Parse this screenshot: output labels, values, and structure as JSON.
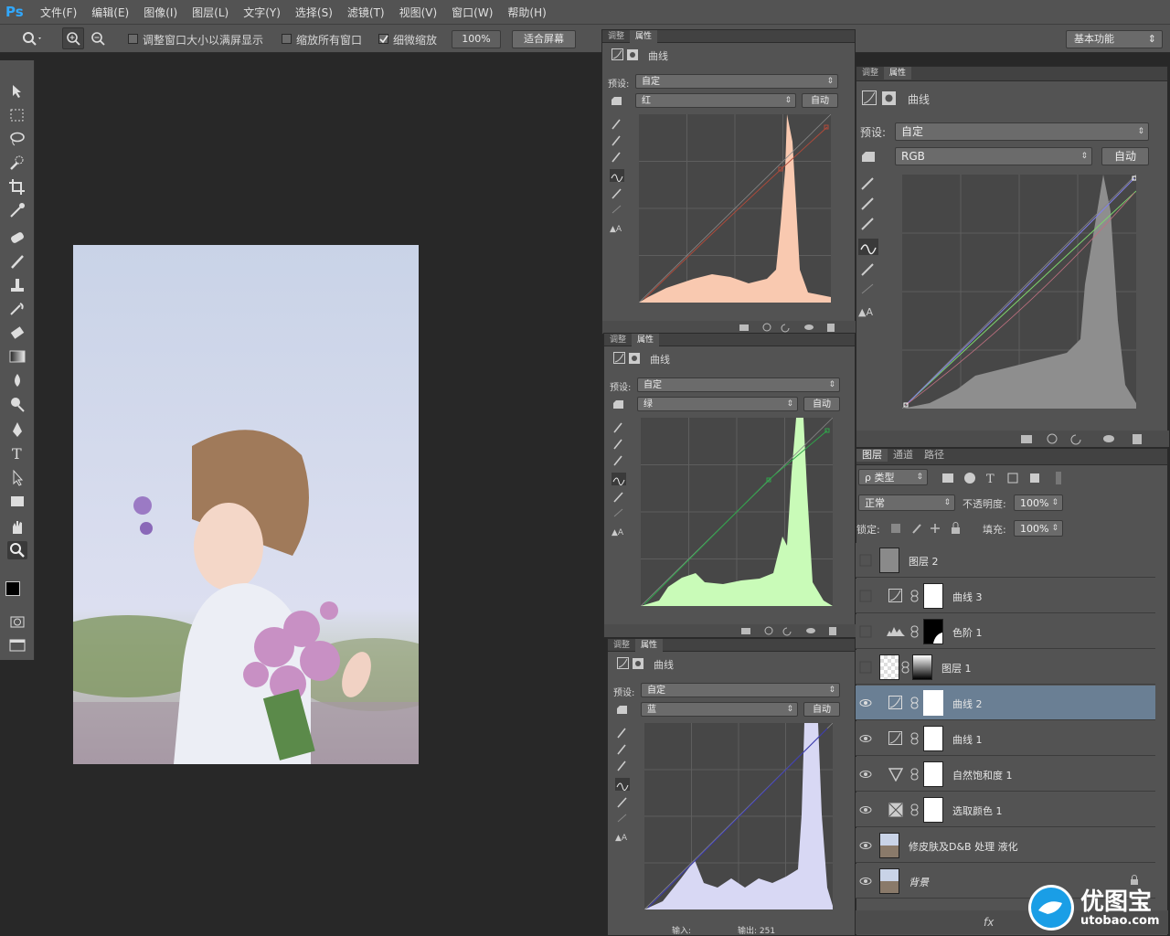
{
  "app": {
    "logo": "Ps"
  },
  "menu": [
    "文件(F)",
    "编辑(E)",
    "图像(I)",
    "图层(L)",
    "文字(Y)",
    "选择(S)",
    "滤镜(T)",
    "视图(V)",
    "窗口(W)",
    "帮助(H)"
  ],
  "options": {
    "resize_windows": "调整窗口大小以满屏显示",
    "zoom_all": "缩放所有窗口",
    "scrubby_zoom": "细微缩放",
    "zoom_value": "100%",
    "fit_screen": "适合屏幕",
    "workspace": "基本功能"
  },
  "curves_red": {
    "tab_adjust": "调整",
    "tab_props": "属性",
    "title": "曲线",
    "preset_label": "预设:",
    "preset": "自定",
    "channel": "红",
    "auto": "自动"
  },
  "curves_green": {
    "tab_adjust": "调整",
    "tab_props": "属性",
    "title": "曲线",
    "preset_label": "预设:",
    "preset": "自定",
    "channel": "绿",
    "auto": "自动"
  },
  "curves_blue": {
    "tab_adjust": "调整",
    "tab_props": "属性",
    "title": "曲线",
    "preset_label": "预设:",
    "preset": "自定",
    "channel": "蓝",
    "auto": "自动",
    "input_label": "输入:",
    "output_label": "输出: 251"
  },
  "curves_rgb": {
    "tab_adjust": "调整",
    "tab_props": "属性",
    "title": "曲线",
    "preset_label": "预设:",
    "preset": "自定",
    "channel": "RGB",
    "auto": "自动"
  },
  "layers_panel": {
    "tabs": [
      "图层",
      "通道",
      "路径"
    ],
    "filter": "ρ 类型",
    "blend_mode": "正常",
    "opacity_label": "不透明度:",
    "opacity": "100%",
    "lock_label": "锁定:",
    "fill_label": "填充:",
    "fill": "100%",
    "layers": [
      {
        "name": "图层 2",
        "visible": false,
        "selected": false
      },
      {
        "name": "曲线 3",
        "visible": false,
        "selected": false
      },
      {
        "name": "色阶 1",
        "visible": false,
        "selected": false
      },
      {
        "name": "图层 1",
        "visible": false,
        "selected": false
      },
      {
        "name": "曲线 2",
        "visible": true,
        "selected": true
      },
      {
        "name": "曲线 1",
        "visible": true,
        "selected": false
      },
      {
        "name": "自然饱和度 1",
        "visible": true,
        "selected": false
      },
      {
        "name": "选取颜色 1",
        "visible": true,
        "selected": false
      },
      {
        "name": "修皮肤及D&B 处理 液化",
        "visible": true,
        "selected": false
      },
      {
        "name": "背景",
        "visible": true,
        "selected": false
      }
    ]
  },
  "watermark": {
    "brand": "优图宝",
    "url": "utobao.com"
  },
  "colors": {
    "panel": "#535353",
    "selected": "#6a7f94",
    "red_hist": "#f9c9b0",
    "green_hist": "#c9fbb8",
    "blue_hist": "#d8d8f4",
    "rgb_hist": "#8e8e8e"
  }
}
